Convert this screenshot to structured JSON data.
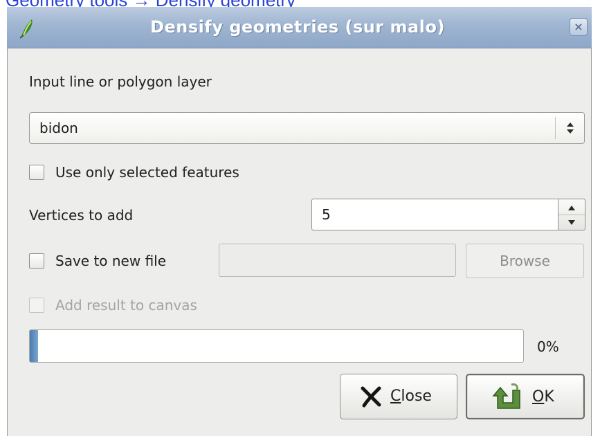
{
  "page_caption": "Geometry tools → Densify geometry",
  "window": {
    "title": "Densify geometries (sur malo)",
    "close_label": "×"
  },
  "input_layer": {
    "label": "Input line or polygon layer",
    "selected": "bidon"
  },
  "selected_features": {
    "label": "Use only selected features",
    "checked": false
  },
  "vertices": {
    "label": "Vertices to add",
    "value": "5"
  },
  "save_file": {
    "label": "Save to new file",
    "checked": false,
    "path": "",
    "browse_label": "Browse"
  },
  "add_result": {
    "label": "Add result to canvas",
    "checked": false,
    "enabled": false
  },
  "progress": {
    "value": 0,
    "text": "0%"
  },
  "buttons": {
    "close_mnemonic": "C",
    "close_rest": "lose",
    "ok_mnemonic": "O",
    "ok_rest": "K"
  },
  "icons": {
    "app": "qgis-logo-icon",
    "close": "close-x-icon",
    "combo_arrows": "updown-arrows-icon",
    "close_button": "x-mark-icon",
    "ok_button": "ok-arrow-icon"
  },
  "colors": {
    "titlebar": "#9fb5d1",
    "dialog_bg": "#ededeb",
    "progress_fill": "#5b8cbf",
    "caption_text": "#2b45d6"
  }
}
